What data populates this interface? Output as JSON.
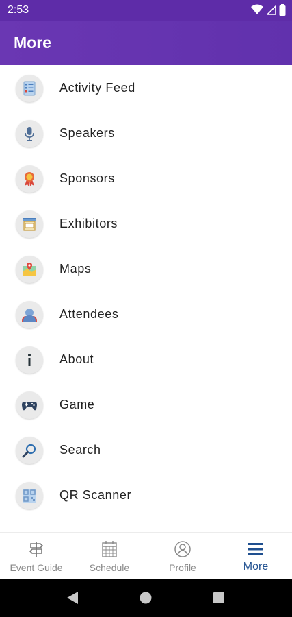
{
  "status_bar": {
    "time": "2:53"
  },
  "app_bar": {
    "title": "More"
  },
  "menu": [
    {
      "label": "Activity Feed",
      "icon": "activity-feed-icon"
    },
    {
      "label": "Speakers",
      "icon": "microphone-icon"
    },
    {
      "label": "Sponsors",
      "icon": "ribbon-award-icon"
    },
    {
      "label": "Exhibitors",
      "icon": "storefront-icon"
    },
    {
      "label": "Maps",
      "icon": "map-pin-icon"
    },
    {
      "label": "Attendees",
      "icon": "people-icon"
    },
    {
      "label": "About",
      "icon": "info-icon"
    },
    {
      "label": "Game",
      "icon": "gamepad-icon"
    },
    {
      "label": "Search",
      "icon": "magnifier-icon"
    },
    {
      "label": "QR Scanner",
      "icon": "qr-code-icon"
    }
  ],
  "bottom_nav": [
    {
      "label": "Event Guide",
      "icon": "signpost-icon"
    },
    {
      "label": "Schedule",
      "icon": "calendar-icon"
    },
    {
      "label": "Profile",
      "icon": "user-circle-icon"
    },
    {
      "label": "More",
      "icon": "hamburger-menu-icon",
      "active": true
    }
  ],
  "colors": {
    "status_bar": "#5e2ca8",
    "app_bar": "#6a37b3",
    "active_nav": "#1f4f8f",
    "inactive_nav": "#8a8a8a"
  }
}
